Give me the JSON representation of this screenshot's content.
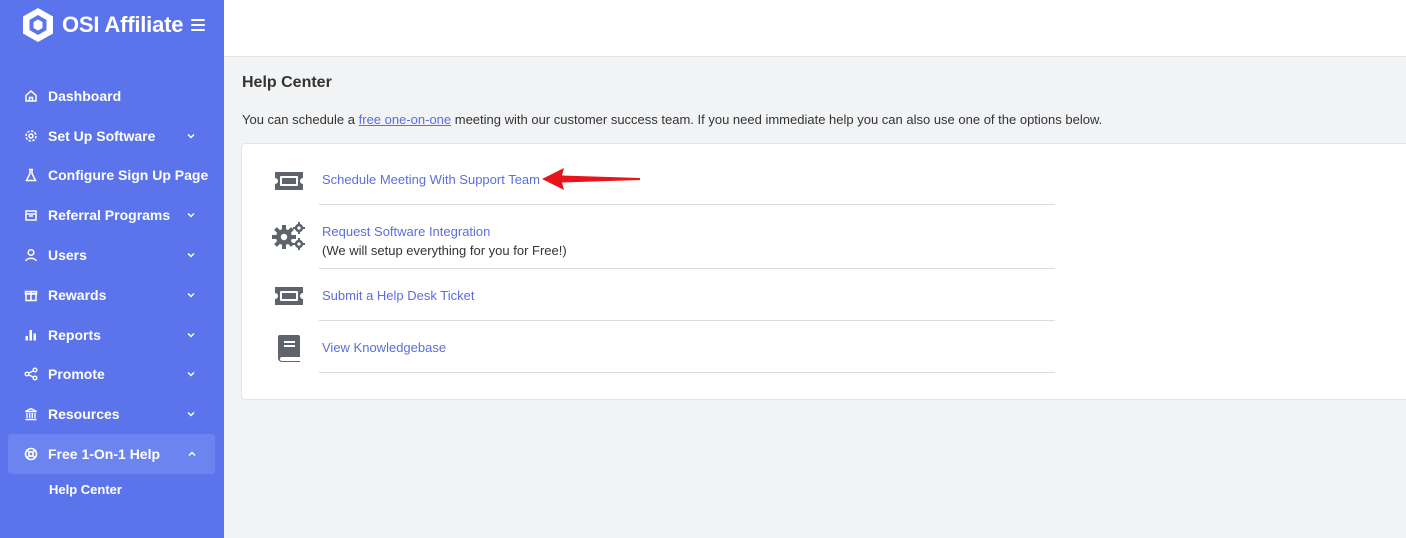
{
  "brand": {
    "title": "OSI Affiliate",
    "logo_icon": "hexagon-logo-icon"
  },
  "colors": {
    "sidebar": "#5b74ec",
    "sidebar_active": "#6c84f0",
    "link": "#5b6fd8",
    "arrow": "#e8141c"
  },
  "sidebar": {
    "items": [
      {
        "label": "Dashboard",
        "icon": "home-icon"
      },
      {
        "label": "Set Up Software",
        "icon": "gear-icon"
      },
      {
        "label": "Configure Sign Up Page",
        "icon": "flask-icon"
      },
      {
        "label": "Referral Programs",
        "icon": "building-icon"
      },
      {
        "label": "Users",
        "icon": "user-icon"
      },
      {
        "label": "Rewards",
        "icon": "gift-icon"
      },
      {
        "label": "Reports",
        "icon": "bar-chart-icon"
      },
      {
        "label": "Promote",
        "icon": "share-icon"
      },
      {
        "label": "Resources",
        "icon": "bank-icon"
      },
      {
        "label": "Free 1-On-1 Help",
        "icon": "life-ring-icon"
      }
    ],
    "sub_items": [
      {
        "label": "Help Center"
      }
    ]
  },
  "main": {
    "title": "Help Center",
    "intro": {
      "before": "You can schedule a ",
      "link": "free one-on-one",
      "after": " meeting with our customer success team. If you need immediate help you can also use one of the options below."
    },
    "options": [
      {
        "label": "Schedule Meeting With Support Team",
        "icon": "ticket-icon"
      },
      {
        "label": "Request Software Integration",
        "sub": "(We will setup everything for you for Free!)",
        "icon": "gears-icon"
      },
      {
        "label": "Submit a Help Desk Ticket",
        "icon": "ticket-icon"
      },
      {
        "label": "View Knowledgebase",
        "icon": "book-icon"
      }
    ]
  }
}
